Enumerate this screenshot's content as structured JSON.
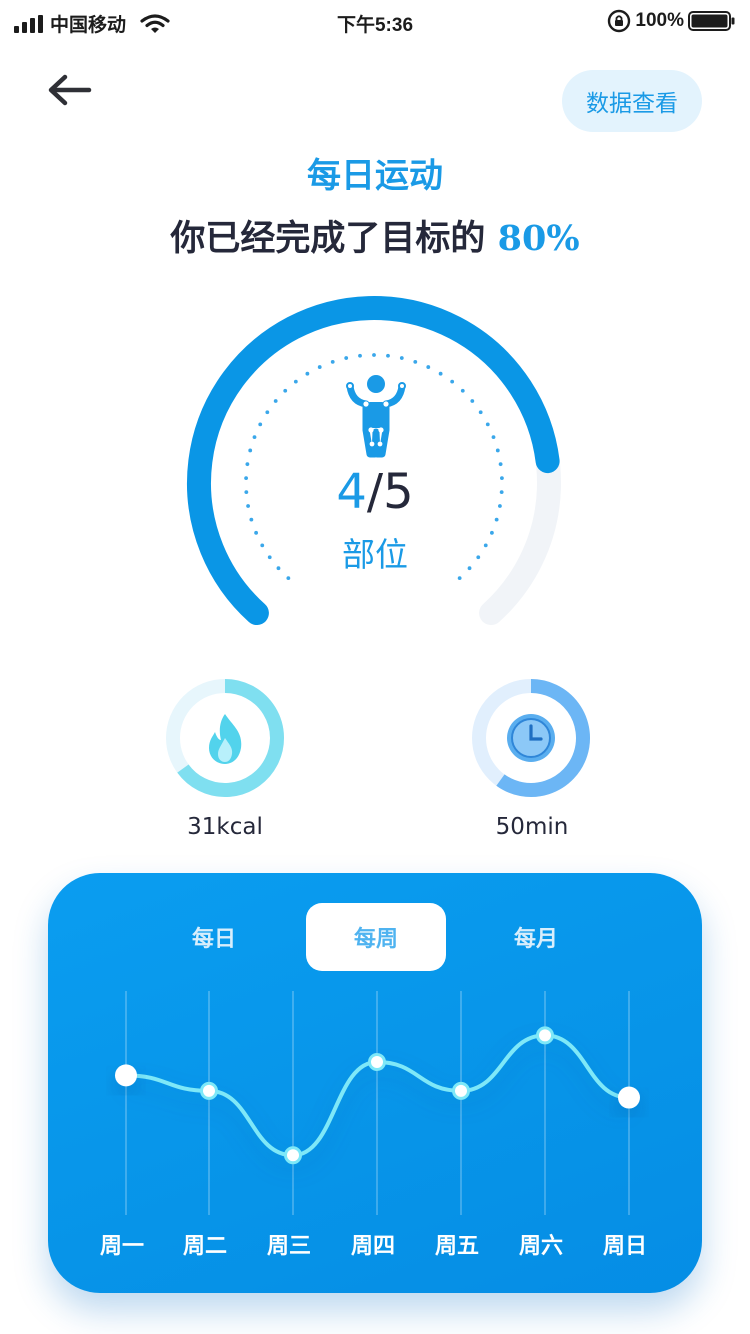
{
  "status_bar": {
    "carrier": "中国移动",
    "time": "下午5:36",
    "battery": "100%"
  },
  "header": {
    "back_icon": "arrow-left-icon",
    "data_button_label": "数据查看"
  },
  "title": "每日运动",
  "subtitle": {
    "prefix": "你已经完成了目标的 ",
    "percent": "80%"
  },
  "progress": {
    "fraction": 0.8,
    "icon": "body-parts-icon",
    "done": "4",
    "separator": "/",
    "total": "5",
    "unit": "部位"
  },
  "stats": [
    {
      "icon": "flame-icon",
      "value": "31kcal",
      "fraction": 0.65,
      "color": "#7fdff0"
    },
    {
      "icon": "clock-icon",
      "value": "50min",
      "fraction": 0.6,
      "color": "#6cb6f5"
    }
  ],
  "card": {
    "tabs": [
      {
        "label": "每日",
        "active": false
      },
      {
        "label": "每周",
        "active": true
      },
      {
        "label": "每月",
        "active": false
      }
    ]
  },
  "colors": {
    "accent": "#1a9ae6",
    "card": "#0794e8",
    "line": "#7ee8f8"
  },
  "chart_data": {
    "type": "line",
    "categories": [
      "周一",
      "周二",
      "周三",
      "周四",
      "周五",
      "周六",
      "周日"
    ],
    "values": [
      62,
      55,
      26,
      68,
      55,
      80,
      52
    ],
    "ylim": [
      0,
      100
    ],
    "grid": "vertical"
  }
}
